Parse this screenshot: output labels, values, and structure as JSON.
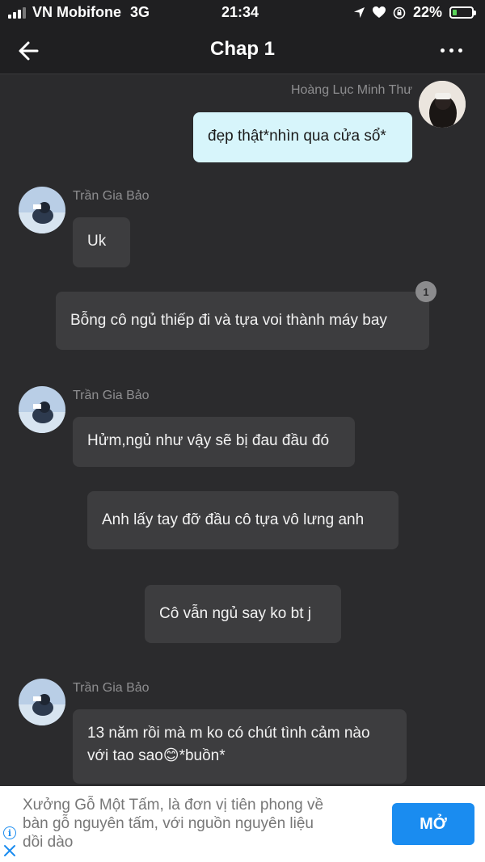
{
  "status_bar": {
    "carrier": "VN Mobifone",
    "network": "3G",
    "time": "21:34",
    "battery_percent": "22%",
    "battery_level": 0.22,
    "icons": [
      "signal-icon",
      "location-arrow-icon",
      "heart-icon",
      "orientation-lock-icon",
      "battery-charging-icon"
    ]
  },
  "header": {
    "title": "Chap 1",
    "back_icon": "arrow-left-icon",
    "more_icon": "more-dots-icon"
  },
  "messages": [
    {
      "sender": "Hoàng Lục Minh Thư",
      "text": "đẹp thật*nhìn qua cửa sổ*",
      "side": "right"
    },
    {
      "sender": "Trần Gia Bảo",
      "text": "Uk",
      "side": "left"
    },
    {
      "sender": "",
      "text": "Bỗng cô ngủ thiếp đi và tựa voi thành máy bay",
      "side": "center",
      "badge": "1"
    },
    {
      "sender": "Trần Gia Bảo",
      "text": "Hửm,ngủ như vậy sẽ bị đau đầu đó",
      "side": "left"
    },
    {
      "sender": "",
      "text": "Anh lấy tay đỡ đầu cô tựa vô lưng anh",
      "side": "center"
    },
    {
      "sender": "",
      "text": "Cô vẫn ngủ say ko bt j",
      "side": "center"
    },
    {
      "sender": "Trần Gia Bảo",
      "text_line1": "13 năm rồi mà m ko có chút tình cảm nào",
      "text_line2": "với tao sao😊*buồn*",
      "side": "left"
    }
  ],
  "colors": {
    "background": "#2b2b2d",
    "bubble_dark": "#3d3d3f",
    "bubble_light": "#d7f5fb",
    "accent": "#1a8cf0"
  },
  "ad": {
    "text_lines": [
      "Xưởng Gỗ Một Tấm, là đơn vị tiên phong về",
      "bàn gỗ nguyên tấm, với nguồn nguyên liệu",
      "dồi dào"
    ],
    "button_label": "MỞ",
    "info_icon": "info-icon",
    "close_icon": "close-icon"
  }
}
